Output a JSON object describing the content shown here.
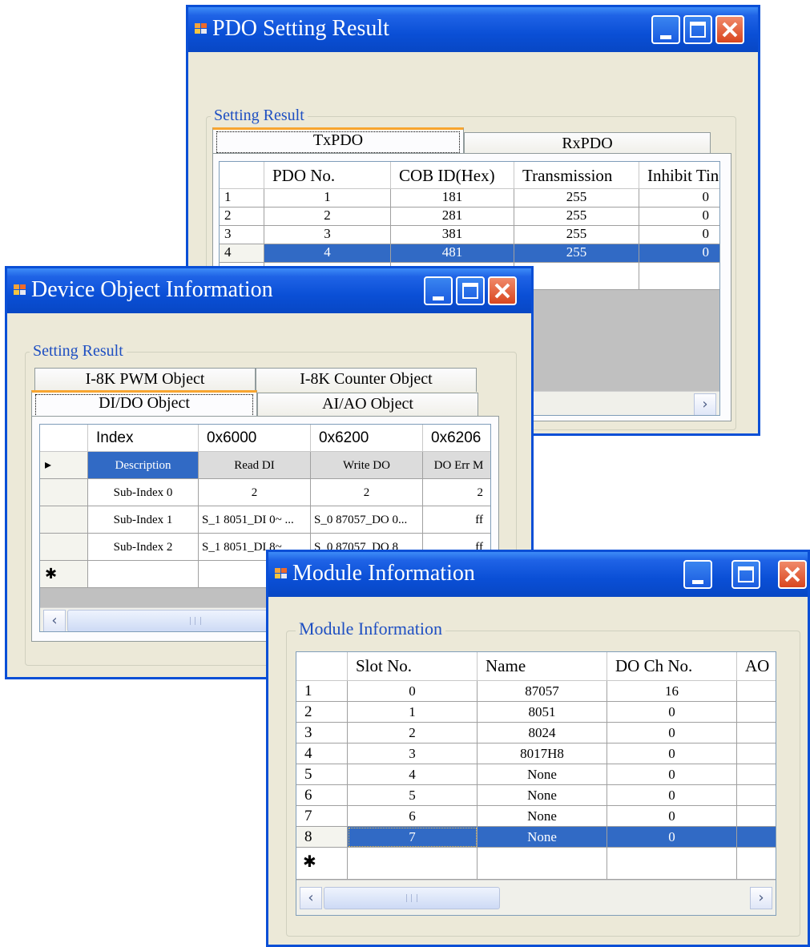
{
  "pdo": {
    "title": "PDO Setting Result",
    "group_label": "Setting Result",
    "tabs": [
      "TxPDO",
      "RxPDO"
    ],
    "columns": [
      "PDO No.",
      "COB ID(Hex)",
      "Transmission",
      "Inhibit Tin"
    ],
    "rows": [
      {
        "num": "1",
        "pdo": "1",
        "cob": "181",
        "trans": "255",
        "inhibit": "0"
      },
      {
        "num": "2",
        "pdo": "2",
        "cob": "281",
        "trans": "255",
        "inhibit": "0"
      },
      {
        "num": "3",
        "pdo": "3",
        "cob": "381",
        "trans": "255",
        "inhibit": "0"
      },
      {
        "num": "4",
        "pdo": "4",
        "cob": "481",
        "trans": "255",
        "inhibit": "0"
      }
    ],
    "scroll_right": "›"
  },
  "device": {
    "title": "Device Object Information",
    "group_label": "Setting Result",
    "tabs": {
      "pwm": "I-8K PWM Object",
      "counter": "I-8K Counter Object",
      "dido": "DI/DO Object",
      "aiao": "AI/AO Object"
    },
    "header": [
      "Index",
      "0x6000",
      "0x6200",
      "0x6206"
    ],
    "rows": [
      {
        "marker": "▸",
        "cells": [
          "Description",
          "Read DI",
          "Write DO",
          "DO Err M"
        ]
      },
      {
        "marker": "",
        "cells": [
          "Sub-Index 0",
          "2",
          "2",
          "2"
        ]
      },
      {
        "marker": "",
        "cells": [
          "Sub-Index 1",
          "S_1 8051_DI 0~ ...",
          "S_0 87057_DO 0...",
          "ff"
        ]
      },
      {
        "marker": "",
        "cells": [
          "Sub-Index 2",
          "S_1 8051_DI 8~",
          "S_0 87057_DO 8",
          "ff"
        ]
      },
      {
        "marker": "✱",
        "cells": [
          "",
          "",
          "",
          ""
        ]
      }
    ],
    "scroll_left": "‹",
    "grip": "III"
  },
  "module": {
    "title": "Module Information",
    "group_label": "Module Information",
    "columns": [
      "Slot No.",
      "Name",
      "DO Ch No.",
      "AO"
    ],
    "rows": [
      {
        "num": "1",
        "slot": "0",
        "name": "87057",
        "do": "16"
      },
      {
        "num": "2",
        "slot": "1",
        "name": "8051",
        "do": "0"
      },
      {
        "num": "3",
        "slot": "2",
        "name": "8024",
        "do": "0"
      },
      {
        "num": "4",
        "slot": "3",
        "name": "8017H8",
        "do": "0"
      },
      {
        "num": "5",
        "slot": "4",
        "name": "None",
        "do": "0"
      },
      {
        "num": "6",
        "slot": "5",
        "name": "None",
        "do": "0"
      },
      {
        "num": "7",
        "slot": "6",
        "name": "None",
        "do": "0"
      },
      {
        "num": "8",
        "slot": "7",
        "name": "None",
        "do": "0"
      }
    ],
    "new_row_marker": "✱",
    "scroll_left": "‹",
    "scroll_right": "›",
    "grip": "III"
  },
  "colors": {
    "titlebar": "#0a4fd6",
    "selection": "#316ac5",
    "group_label": "#1e4fc2",
    "close": "#d9461f"
  }
}
